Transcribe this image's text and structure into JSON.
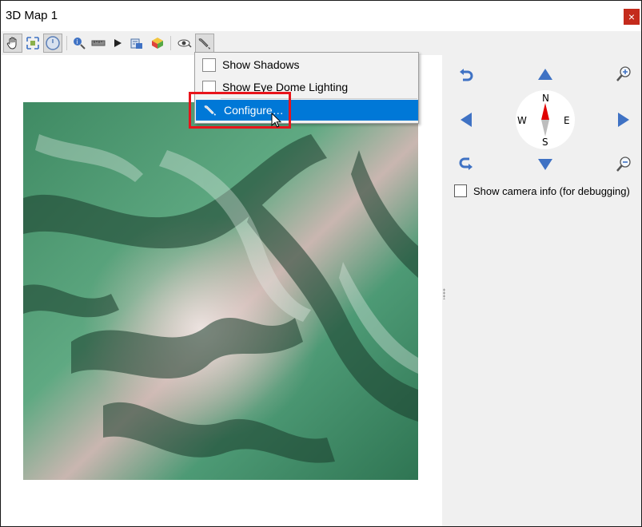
{
  "window": {
    "title": "3D Map 1",
    "close_glyph": "×"
  },
  "toolbar": {
    "tools": [
      {
        "name": "pan-hand-icon"
      },
      {
        "name": "zoom-full-icon"
      },
      {
        "name": "camera-control-icon"
      },
      {
        "name": "identify-icon"
      },
      {
        "name": "measure-line-icon"
      },
      {
        "name": "play-animation-icon"
      },
      {
        "name": "export-scene-icon"
      },
      {
        "name": "map-themes-icon"
      },
      {
        "name": "camera-view-icon"
      },
      {
        "name": "options-wrench-icon"
      }
    ]
  },
  "options_menu": {
    "items": [
      {
        "label": "Show Shadows",
        "checked": false
      },
      {
        "label": "Show Eye Dome Lighting",
        "checked": false
      },
      {
        "label": "Configure…",
        "icon": "wrench-icon",
        "highlighted": true
      }
    ]
  },
  "navigation": {
    "compass": {
      "north": "N",
      "south": "S",
      "east": "E",
      "west": "W"
    },
    "show_camera_info": {
      "label": "Show camera info (for debugging)",
      "checked": false
    }
  },
  "colors": {
    "menu_highlight": "#0078d7",
    "annotation_box": "#e8141b",
    "nav_arrow": "#3f72c4",
    "compass_needle_north": "#e00000"
  }
}
